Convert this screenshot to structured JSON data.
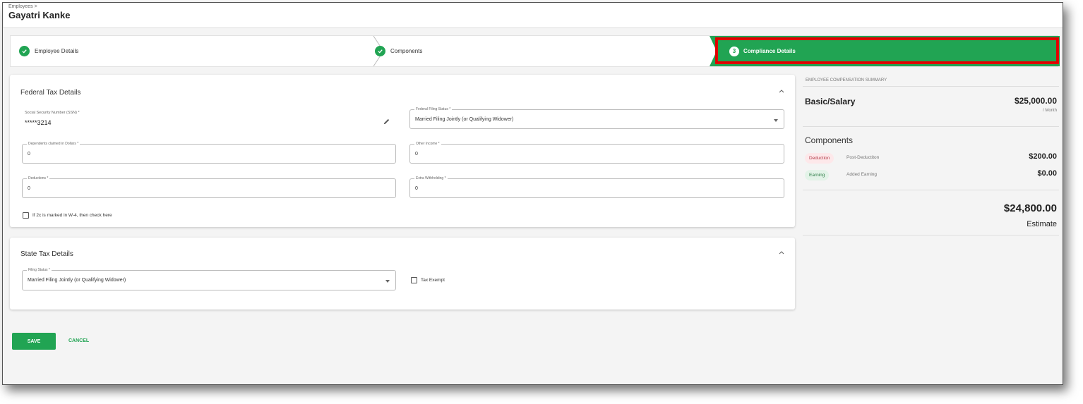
{
  "header": {
    "breadcrumb": "Employees >",
    "title": "Gayatri Kanke"
  },
  "stepper": {
    "steps": [
      {
        "label": "Employee Details",
        "status": "complete"
      },
      {
        "label": "Components",
        "status": "complete"
      },
      {
        "label": "Compliance Details",
        "status": "active",
        "number": "3"
      }
    ]
  },
  "federal": {
    "title": "Federal Tax Details",
    "ssn_label": "Social Security Number (SSN) *",
    "ssn_value": "*****3214",
    "filing_status_label": "Federal Filing Status *",
    "filing_status_value": "Married Filing Jointly (or Qualifying Widower)",
    "dependents_label": "Dependents claimed in Dollars *",
    "dependents_value": "0",
    "other_income_label": "Other Income *",
    "other_income_value": "0",
    "deductions_label": "Deductions *",
    "deductions_value": "0",
    "extra_withholding_label": "Extra Withholding *",
    "extra_withholding_value": "0",
    "w4_checkbox_label": "If 2c is marked in W-4, then check here"
  },
  "state": {
    "title": "State Tax Details",
    "filing_status_label": "Filing Status *",
    "filing_status_value": "Married Filing Jointly (or Qualifying Widower)",
    "tax_exempt_label": "Tax Exempt"
  },
  "summary": {
    "heading": "EMPLOYEE COMPENSATION SUMMARY",
    "basic_label": "Basic/Salary",
    "basic_amount": "$25,000.00",
    "per_month": "/ Month",
    "components_title": "Components",
    "components": [
      {
        "type": "Deduction",
        "name": "Post-Deductiton",
        "amount": "$200.00"
      },
      {
        "type": "Earning",
        "name": "Added Earning",
        "amount": "$0.00"
      }
    ],
    "total": "$24,800.00",
    "estimate_label": "Estimate"
  },
  "actions": {
    "save_label": "SAVE",
    "cancel_label": "CANCEL"
  },
  "colors": {
    "accent": "#21a453",
    "highlight": "#e00000"
  },
  "icons": {
    "step_complete": "check-circle-icon",
    "ssn_edit": "pencil-icon",
    "collapse": "chevron-up-icon",
    "dropdown": "caret-down-icon"
  }
}
